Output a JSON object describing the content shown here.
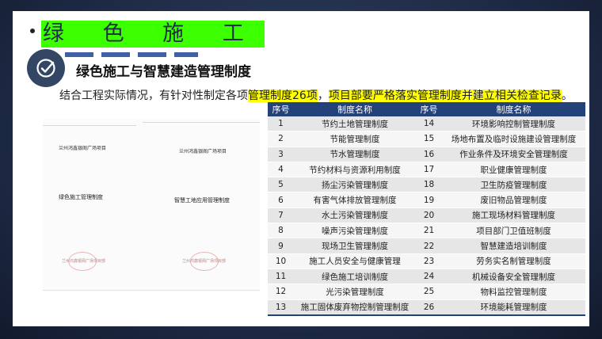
{
  "title": "绿 色 施 工",
  "subtitle": "绿色施工与智慧建造管理制度",
  "statement": {
    "prefix": "结合工程实际情况，有针对性制定各项",
    "highlight1": "管理制度26项",
    "mid": "，",
    "highlight2": "项目部要严格落实管理制度并建立相关检查记录",
    "suffix": "。"
  },
  "documents": [
    {
      "header": "兰州鸿鑫银阁广场项目",
      "label": "绿色施工管理制度",
      "seal": "兰州鸿鑫银阁广场项目部"
    },
    {
      "header": "兰州鸿鑫银阁广场项目",
      "label": "智慧工地应用管理制度",
      "seal": "兰州鸿鑫银阁广场项目部"
    }
  ],
  "table": {
    "headers": [
      "序号",
      "制度名称",
      "序号",
      "制度名称"
    ],
    "rows": [
      [
        "1",
        "节约土地管理制度",
        "14",
        "环境影响控制管理制度"
      ],
      [
        "2",
        "节能管理制度",
        "15",
        "场地布置及临时设施建设管理制度"
      ],
      [
        "3",
        "节水管理制度",
        "16",
        "作业条件及环境安全管理制度"
      ],
      [
        "4",
        "节约材料与资源利用制度",
        "17",
        "职业健康管理制度"
      ],
      [
        "5",
        "扬尘污染管理制度",
        "18",
        "卫生防疫管理制度"
      ],
      [
        "6",
        "有害气体排放管理制度",
        "19",
        "废旧物品管理制度"
      ],
      [
        "7",
        "水土污染管理制度",
        "20",
        "施工现场材料管理制度"
      ],
      [
        "8",
        "噪声污染管理制度",
        "21",
        "项目部门卫值班制度"
      ],
      [
        "9",
        "现场卫生管理制度",
        "22",
        "智慧建造培训制度"
      ],
      [
        "10",
        "施工人员安全与健康管理",
        "23",
        "劳务实名制管理制度"
      ],
      [
        "11",
        "绿色施工培训制度",
        "24",
        "机械设备安全管理制度"
      ],
      [
        "12",
        "光污染管理制度",
        "25",
        "物料监控管理制度"
      ],
      [
        "13",
        "施工固体废弃物控制管理制度",
        "26",
        "环境能耗管理制度"
      ]
    ]
  },
  "icons": {
    "badge": "checkmark-icon",
    "bullet": "bullet-dot-icon"
  },
  "colors": {
    "title_highlight": "#3cff00",
    "text_highlight": "#ffff00",
    "table_header": "#24427a",
    "badge": "#334765"
  }
}
